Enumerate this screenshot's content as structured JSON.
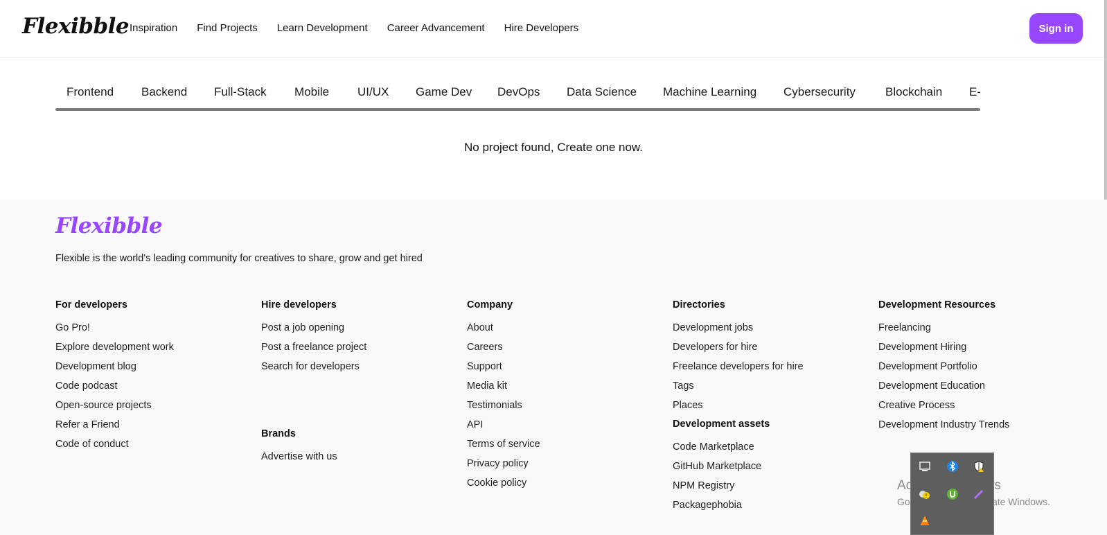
{
  "navbar": {
    "logo": "Flexibble",
    "links": [
      "Inspiration",
      "Find Projects",
      "Learn Development",
      "Career Advancement",
      "Hire Developers"
    ],
    "signin_label": "Sign in"
  },
  "categories": [
    "Frontend",
    "Backend",
    "Full-Stack",
    "Mobile",
    "UI/UX",
    "Game Dev",
    "DevOps",
    "Data Science",
    "Machine Learning",
    "Cybersecurity",
    "Blockchain",
    "E-Commerce"
  ],
  "empty_message": "No project found, Create one now.",
  "footer": {
    "logo": "Flexibble",
    "tagline": "Flexible is the world's leading community for creatives to share, grow and get hired",
    "columns": [
      {
        "heading": "For developers",
        "links": [
          "Go Pro!",
          "Explore development work",
          "Development blog",
          "Code podcast",
          "Open-source projects",
          "Refer a Friend",
          "Code of conduct"
        ]
      },
      {
        "heading": "Hire developers",
        "links": [
          "Post a job opening",
          "Post a freelance project",
          "Search for developers"
        ],
        "sub_heading": "Brands",
        "sub_links": [
          "Advertise with us"
        ]
      },
      {
        "heading": "Company",
        "links": [
          "About",
          "Careers",
          "Support",
          "Media kit",
          "Testimonials",
          "API",
          "Terms of service",
          "Privacy policy",
          "Cookie policy"
        ]
      },
      {
        "heading": "Directories",
        "links": [
          "Development jobs",
          "Developers for hire",
          "Freelance developers for hire",
          "Tags",
          "Places"
        ],
        "sub_heading": "Development assets",
        "sub_links": [
          "Code Marketplace",
          "GitHub Marketplace",
          "NPM Registry",
          "Packagephobia"
        ]
      },
      {
        "heading": "Development Resources",
        "links": [
          "Freelancing",
          "Development Hiring",
          "Development Portfolio",
          "Development Education",
          "Creative Process",
          "Development Industry Trends"
        ]
      }
    ]
  },
  "windows_watermark": {
    "title": "Activate Windows",
    "subtitle": "Go to Settings to activate Windows."
  },
  "tray_icons": [
    "monitor-icon",
    "bluetooth-icon",
    "security-shield-icon",
    "warning-icon",
    "utorrent-icon",
    "pen-icon",
    "vlc-icon"
  ],
  "colors": {
    "accent": "#9747ff",
    "footer_bg": "#f9f9f9"
  }
}
